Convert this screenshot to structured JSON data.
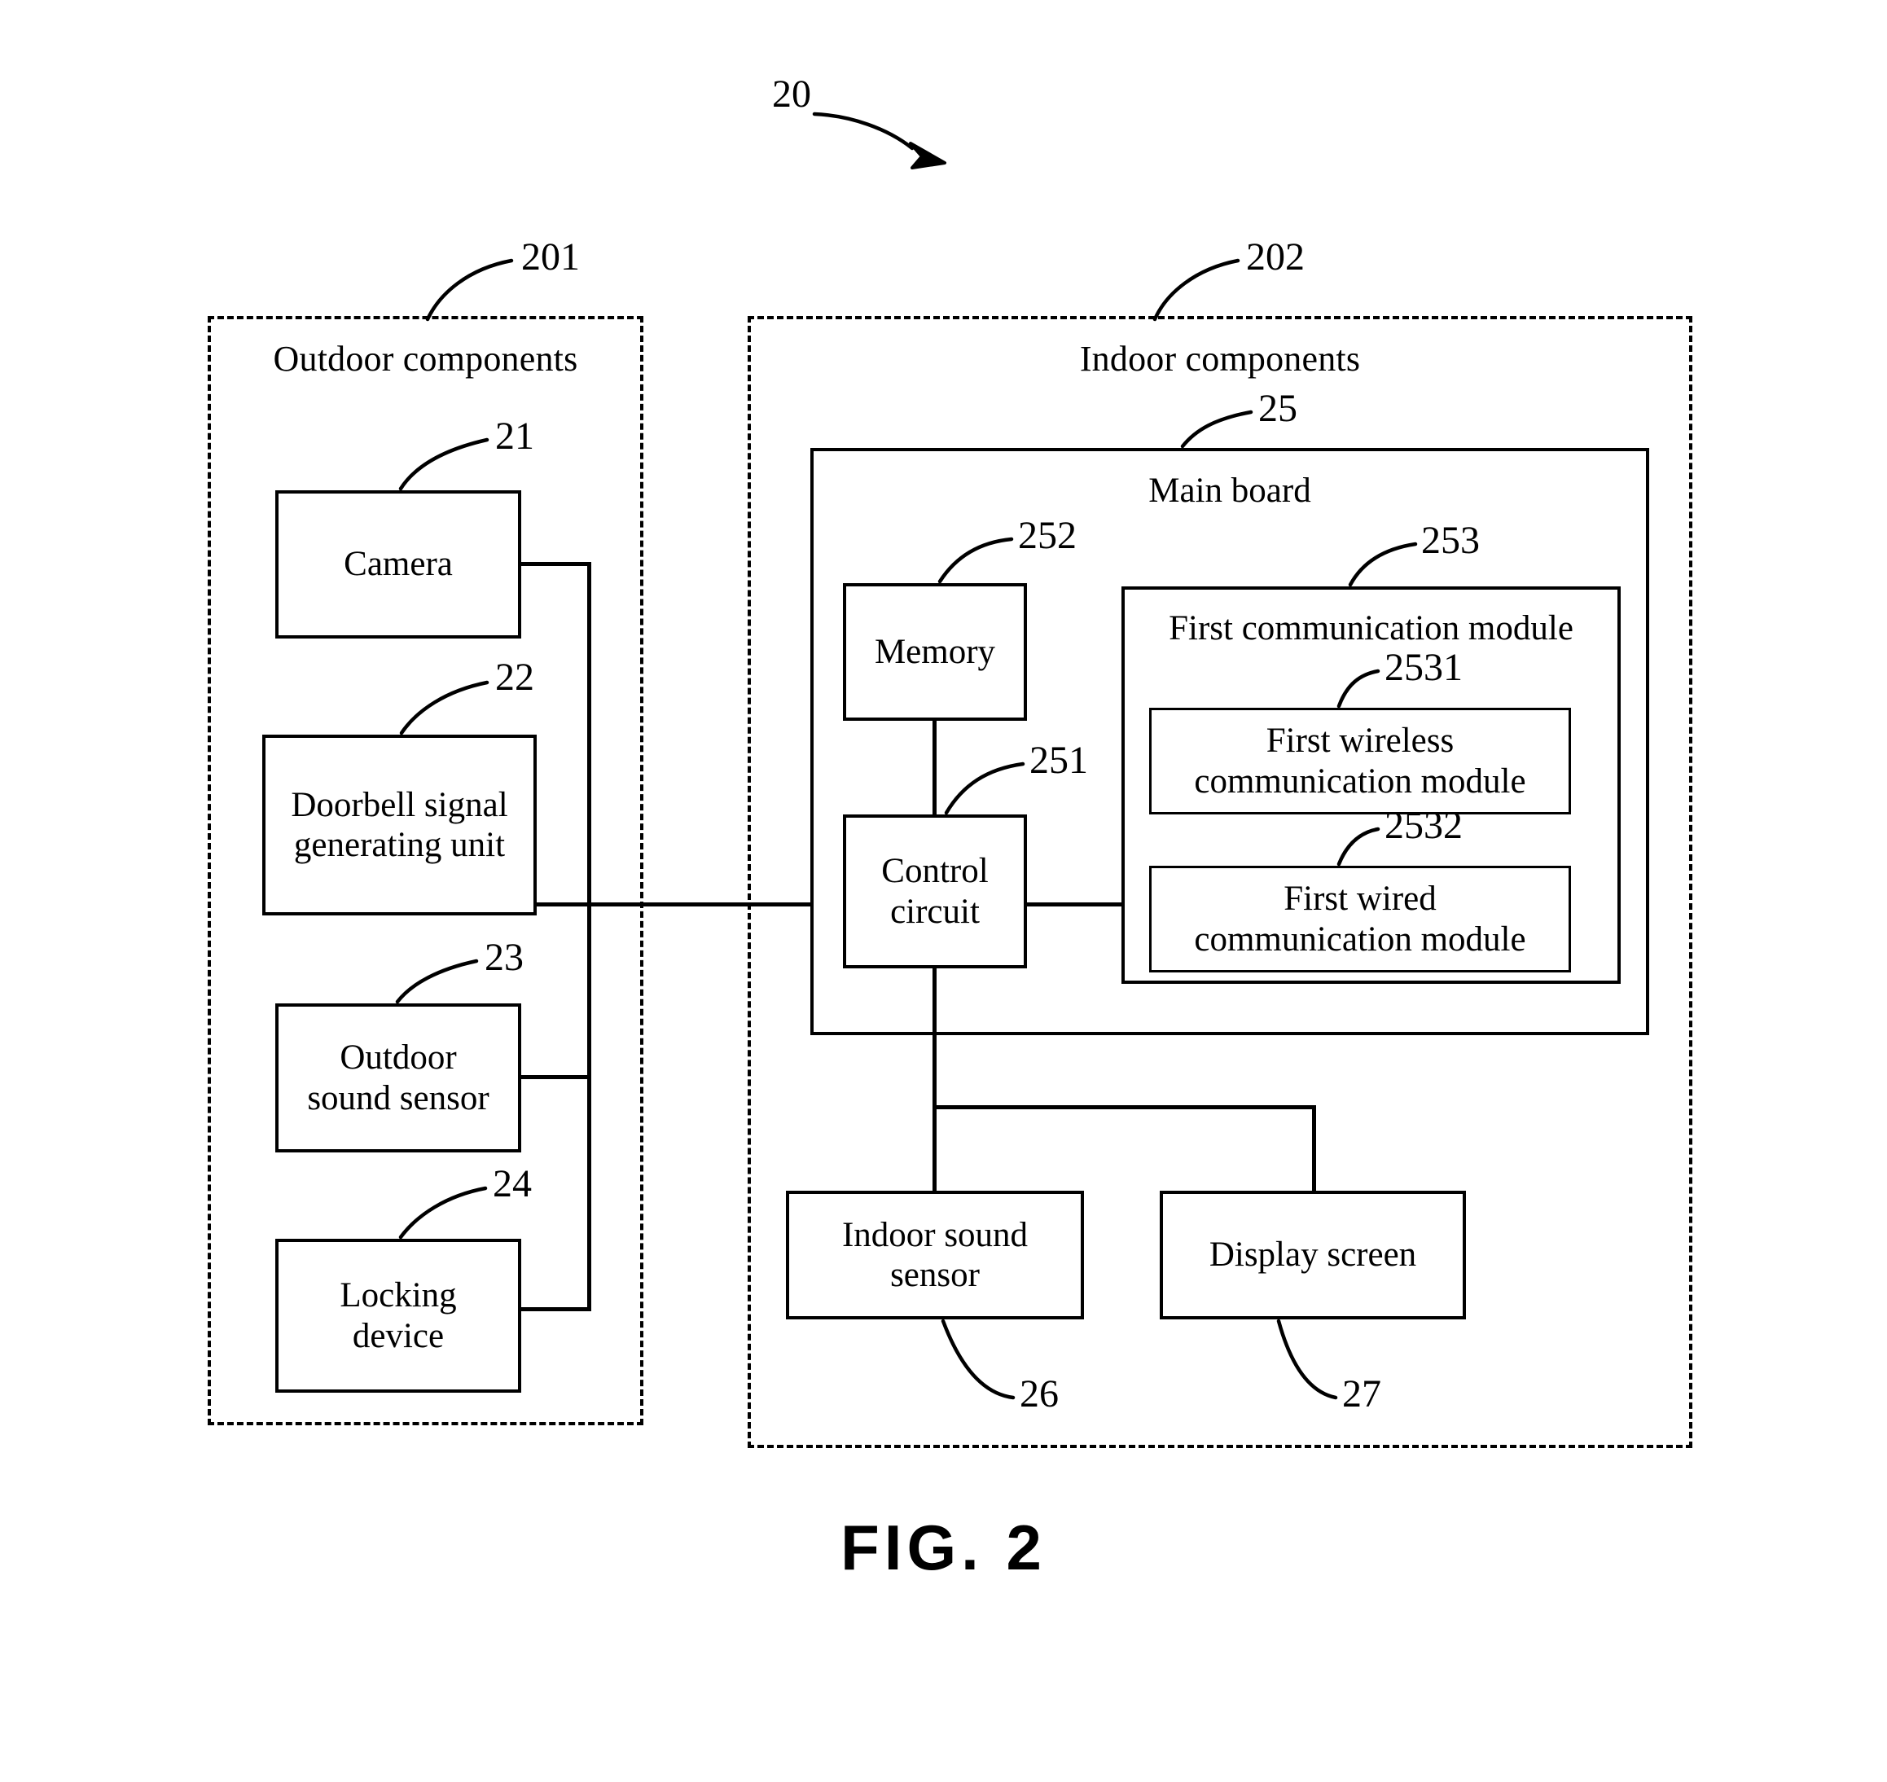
{
  "figure": {
    "caption": "FIG. 2",
    "system_ref": "20"
  },
  "groups": {
    "outdoor": {
      "title": "Outdoor components",
      "ref": "201"
    },
    "indoor": {
      "title": "Indoor components",
      "ref": "202"
    }
  },
  "outdoor_blocks": [
    {
      "label": "Camera",
      "ref": "21"
    },
    {
      "label": "Doorbell signal\ngenerating unit",
      "ref": "22"
    },
    {
      "label": "Outdoor\nsound sensor",
      "ref": "23"
    },
    {
      "label": "Locking\ndevice",
      "ref": "24"
    }
  ],
  "main_board": {
    "label": "Main board",
    "ref": "25"
  },
  "main_board_blocks": [
    {
      "label": "Memory",
      "ref": "252"
    },
    {
      "label": "Control\ncircuit",
      "ref": "251"
    }
  ],
  "communication": {
    "label": "First communication module",
    "ref": "253",
    "children": [
      {
        "label": "First wireless\ncommunication module",
        "ref": "2531"
      },
      {
        "label": "First wired\ncommunication module",
        "ref": "2532"
      }
    ]
  },
  "indoor_blocks": [
    {
      "label": "Indoor sound\nsensor",
      "ref": "26"
    },
    {
      "label": "Display screen",
      "ref": "27"
    }
  ],
  "colors": {
    "ink": "#000000",
    "paper": "#ffffff"
  }
}
